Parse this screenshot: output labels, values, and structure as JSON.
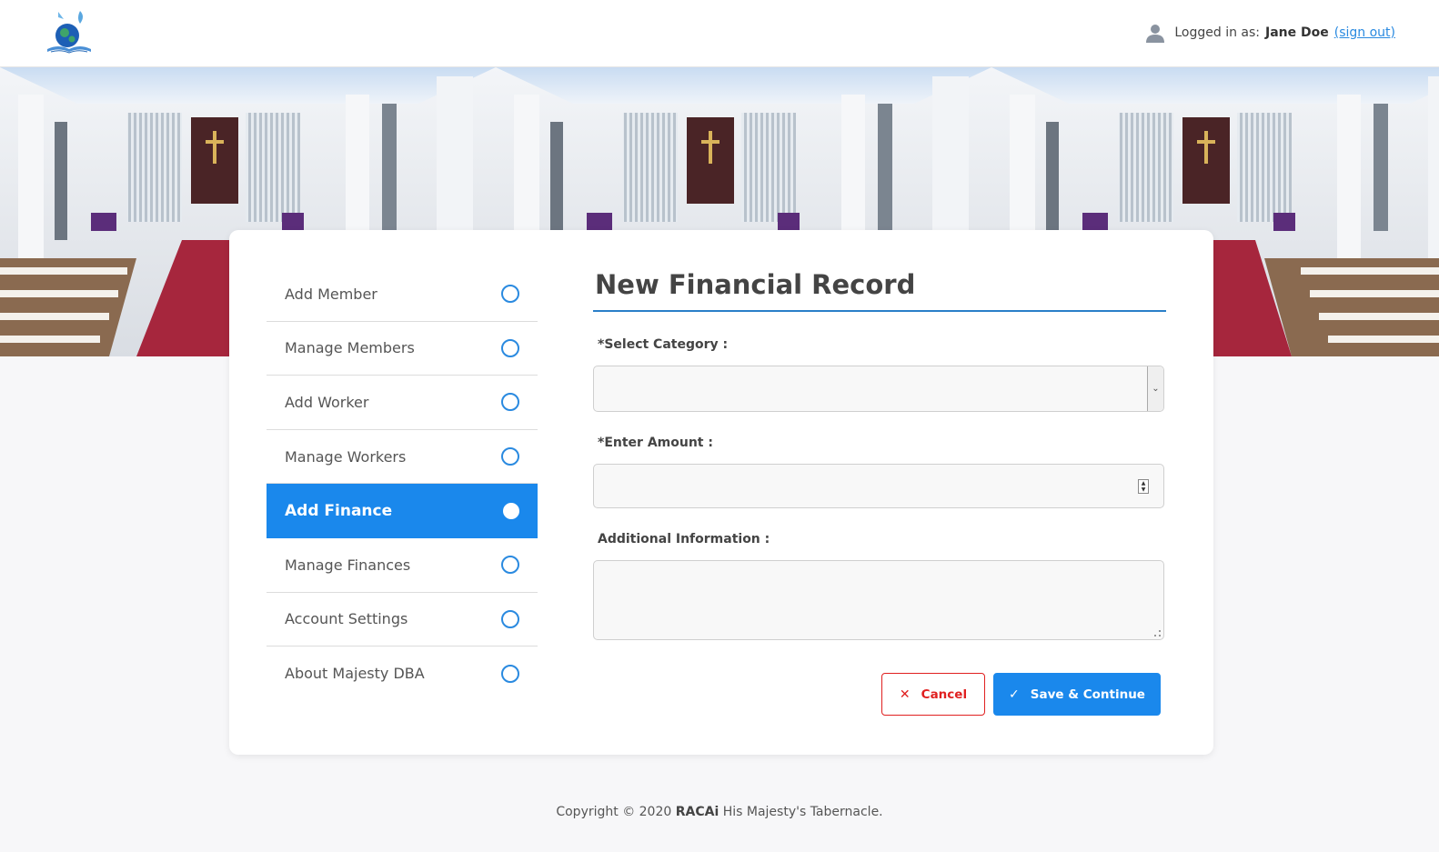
{
  "header": {
    "logged_in_prefix": "Logged in as:",
    "user_name": "Jane Doe",
    "sign_out": "(sign out)"
  },
  "menu": {
    "items": [
      {
        "label": "Add Member"
      },
      {
        "label": "Manage Members"
      },
      {
        "label": "Add Worker"
      },
      {
        "label": "Manage Workers"
      },
      {
        "label": "Add Finance",
        "active": true
      },
      {
        "label": "Manage Finances"
      },
      {
        "label": "Account Settings"
      },
      {
        "label": "About Majesty DBA"
      }
    ]
  },
  "form": {
    "title": "New Financial Record",
    "category_label": "*Select Category :",
    "category_value": "",
    "amount_label": "*Enter Amount :",
    "amount_value": "",
    "info_label": "Additional Information :",
    "info_value": "",
    "cancel_label": "Cancel",
    "save_label": "Save & Continue"
  },
  "footer": {
    "prefix": "Copyright © 2020",
    "brand": "RACAi",
    "suffix": "His Majesty's Tabernacle."
  },
  "colors": {
    "accent": "#1a88ec",
    "cancel": "#e02020",
    "background": "#f7f7f9"
  },
  "icons": {
    "logo": "church-logo-icon",
    "user": "user-icon",
    "cancel": "close-icon",
    "save": "check-icon",
    "menu_marker": "circle-icon"
  }
}
